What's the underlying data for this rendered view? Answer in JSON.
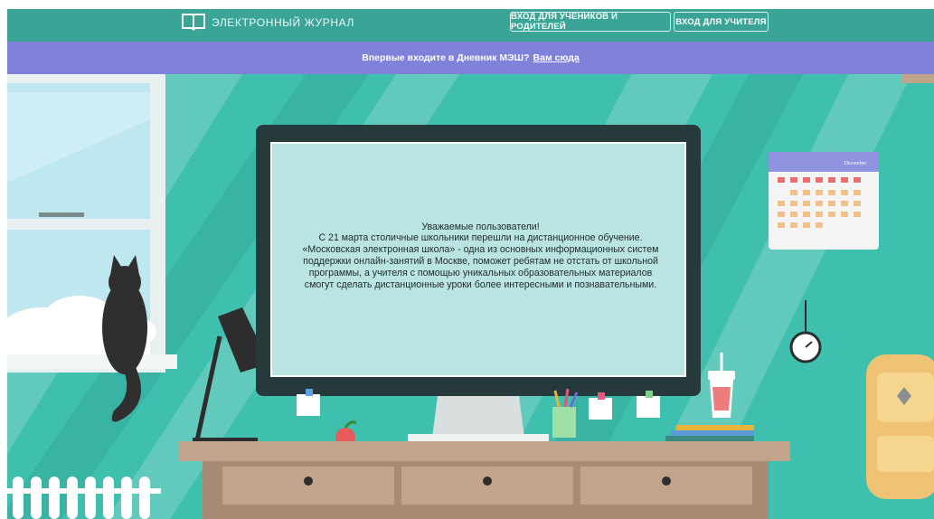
{
  "header": {
    "logo_icon": "open-book-icon",
    "title": "ЭЛЕКТРОННЫЙ ЖУРНАЛ",
    "btn_students": "ВХОД ДЛЯ УЧЕНИКОВ И РОДИТЕЛЕЙ",
    "btn_teacher": "ВХОД ДЛЯ УЧИТЕЛЯ"
  },
  "banner": {
    "text": "Впервые входите в Дневник МЭШ?",
    "link": "Вам сюда"
  },
  "monitor": {
    "lines": [
      "Уважаемые пользователи!",
      "С 21 марта столичные школьники перешли на дистанционное обучение.",
      "«Московская электронная школа» - одна из основных информационных систем",
      "поддержки онлайн-занятий в Москве, поможет ребятам не отстать от школьной",
      "программы, а учителя с помощью уникальных образовательных материалов",
      "смогут сделать дистанционные уроки более интересными и познавательными."
    ]
  },
  "calendar": {
    "month": "December"
  },
  "colors": {
    "topbar": "#3aa597",
    "banner": "#7f82d8",
    "wall": "#3fbfae",
    "screen": "#b9e4e2",
    "desk": "#c2a48c"
  }
}
